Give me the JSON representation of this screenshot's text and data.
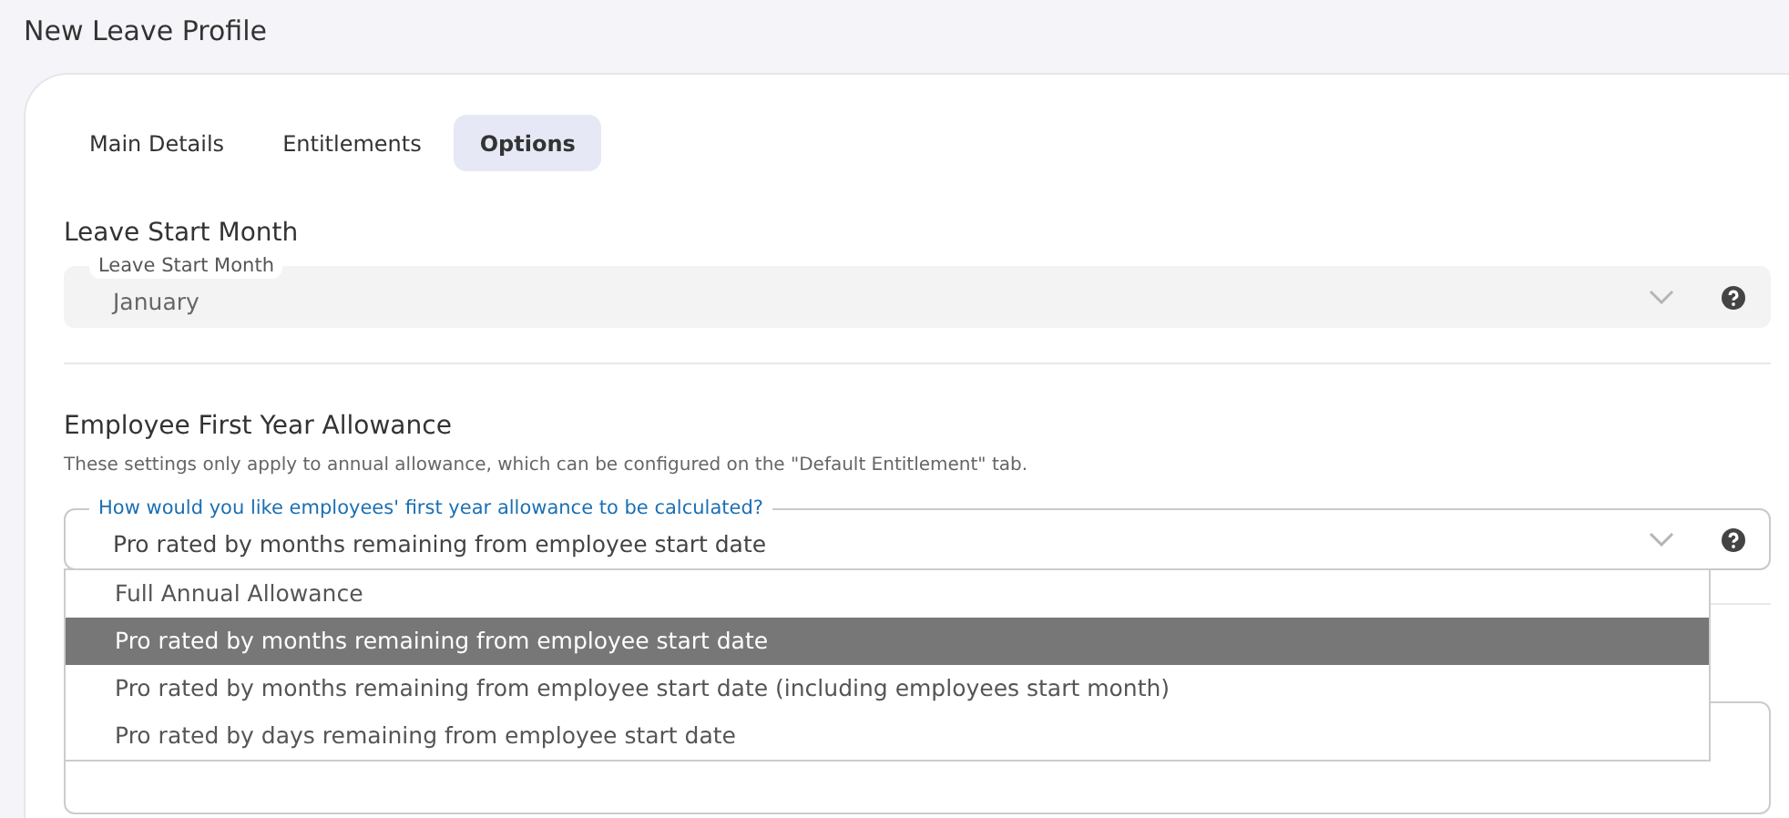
{
  "page_title": "New Leave Profile",
  "tabs": [
    {
      "label": "Main Details",
      "selected": false
    },
    {
      "label": "Entitlements",
      "selected": false
    },
    {
      "label": "Options",
      "selected": true
    }
  ],
  "leave_start": {
    "heading": "Leave Start Month",
    "field_label": "Leave Start Month",
    "value": "January",
    "disabled": true
  },
  "first_year": {
    "heading": "Employee First Year Allowance",
    "note": "These settings only apply to annual allowance, which can be configured on the \"Default Entitlement\" tab.",
    "field_label": "How would you like employees' first year allowance to be calculated?",
    "value": "Pro rated by months remaining from employee start date",
    "expanded": true,
    "options": [
      {
        "label": "Full Annual Allowance",
        "selected": false
      },
      {
        "label": "Pro rated by months remaining from employee start date",
        "selected": true
      },
      {
        "label": "Pro rated by months remaining from employee start date (including employees start month)",
        "selected": false
      },
      {
        "label": "Pro rated by days remaining from employee start date",
        "selected": false
      }
    ]
  }
}
